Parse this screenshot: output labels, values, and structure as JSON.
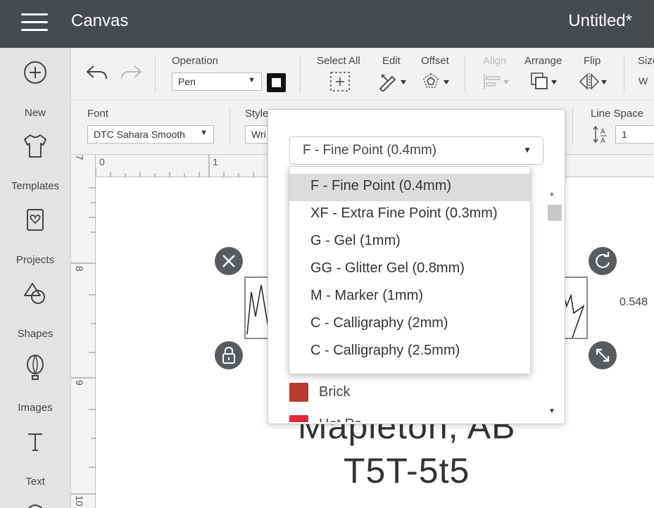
{
  "header": {
    "app_title": "Canvas",
    "doc_title": "Untitled*"
  },
  "sidebar": {
    "items": [
      {
        "label": "New",
        "icon": "plus-circle-icon"
      },
      {
        "label": "Templates",
        "icon": "tshirt-icon"
      },
      {
        "label": "Projects",
        "icon": "heart-card-icon"
      },
      {
        "label": "Shapes",
        "icon": "shapes-icon"
      },
      {
        "label": "Images",
        "icon": "balloon-icon"
      },
      {
        "label": "Text",
        "icon": "text-t-icon"
      }
    ]
  },
  "toolbar": {
    "operation_label": "Operation",
    "operation_value": "Pen",
    "select_all_label": "Select All",
    "edit_label": "Edit",
    "offset_label": "Offset",
    "align_label": "Align",
    "arrange_label": "Arrange",
    "flip_label": "Flip",
    "size_label": "Size",
    "size_w": "W",
    "font_label": "Font",
    "font_value": "DTC Sahara Smooth",
    "style_label": "Style",
    "style_value": "Wri",
    "line_space_label": "Line Space",
    "line_space_value": "1"
  },
  "canvas": {
    "ruler_top": [
      "0",
      "1"
    ],
    "ruler_left": [
      "7",
      "8",
      "9",
      "10"
    ],
    "dimension_readout": "0.548",
    "text_line1": "Mapleton, AB",
    "text_line2": "T5T-5t5"
  },
  "pen_panel": {
    "selected": "F - Fine Point (0.4mm)",
    "options": [
      "F - Fine Point (0.4mm)",
      "XF - Extra Fine Point (0.3mm)",
      "G - Gel (1mm)",
      "GG - Glitter Gel (0.8mm)",
      "M - Marker (1mm)",
      "C - Calligraphy (2mm)",
      "C - Calligraphy (2.5mm)"
    ],
    "colors": [
      {
        "name": "Brick",
        "color": "#b73b30"
      },
      {
        "name": "Hot Pe",
        "color": "#e02a3a"
      }
    ]
  },
  "colors": {
    "header_bg": "#474a4f",
    "sidebar_bg": "#e3e3e3",
    "toolbar_bg": "#f2f2f2",
    "handle_bg": "#585c61"
  }
}
